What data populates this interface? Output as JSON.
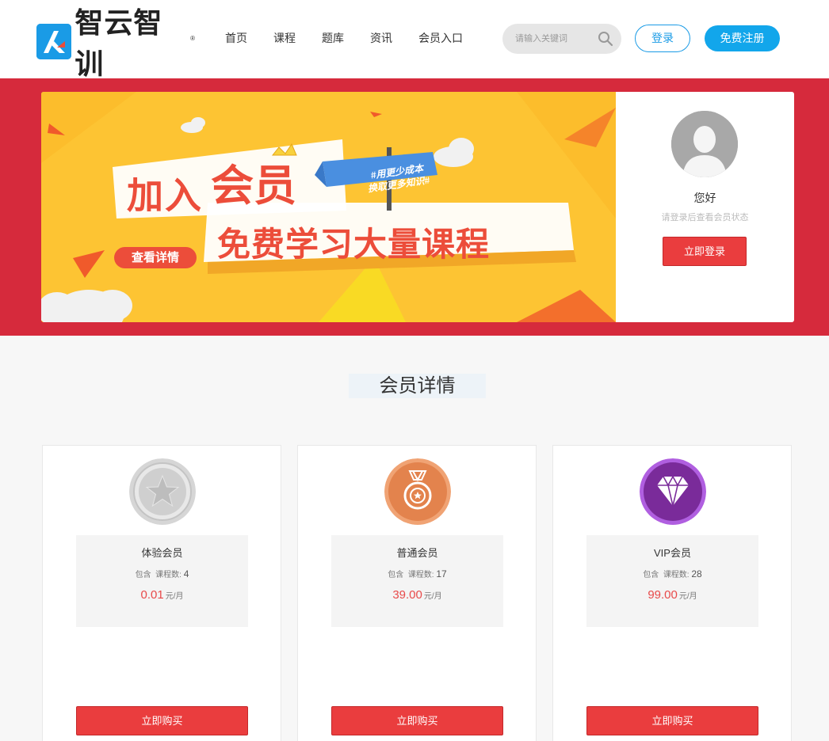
{
  "header": {
    "logo_text": "智云智训",
    "logo_mark": "®",
    "nav": [
      "首页",
      "课程",
      "题库",
      "资讯",
      "会员入口"
    ],
    "search_placeholder": "请输入关键词",
    "login_label": "登录",
    "register_label": "免费注册",
    "colors": {
      "primary": "#12a6eb"
    }
  },
  "banner": {
    "line1": "加入",
    "line1_highlight": "会员",
    "line2": "免费学习大量课程",
    "sign_line1": "#用更少成本",
    "sign_line2": "换取更多知识#",
    "detail_button": "查看详情",
    "colors": {
      "band": "#d62a3c",
      "banner_bg": "#fdc433",
      "text": "#ec4d3a"
    }
  },
  "user_panel": {
    "avatar_icon": "user-silhouette-icon",
    "greeting": "您好",
    "hint": "请登录后查看会员状态",
    "login_now_label": "立即登录"
  },
  "section": {
    "title": "会员详情"
  },
  "memberships": [
    {
      "name": "体验会员",
      "includes_label": "包含",
      "courses_label": "课程数:",
      "courses": "4",
      "price": "0.01",
      "unit": "元/月",
      "buy_label": "立即购买",
      "icon": "silver-star-icon"
    },
    {
      "name": "普通会员",
      "includes_label": "包含",
      "courses_label": "课程数:",
      "courses": "17",
      "price": "39.00",
      "unit": "元/月",
      "buy_label": "立即购买",
      "icon": "bronze-medal-icon"
    },
    {
      "name": "VIP会员",
      "includes_label": "包含",
      "courses_label": "课程数:",
      "courses": "28",
      "price": "99.00",
      "unit": "元/月",
      "buy_label": "立即购买",
      "icon": "diamond-icon"
    }
  ]
}
